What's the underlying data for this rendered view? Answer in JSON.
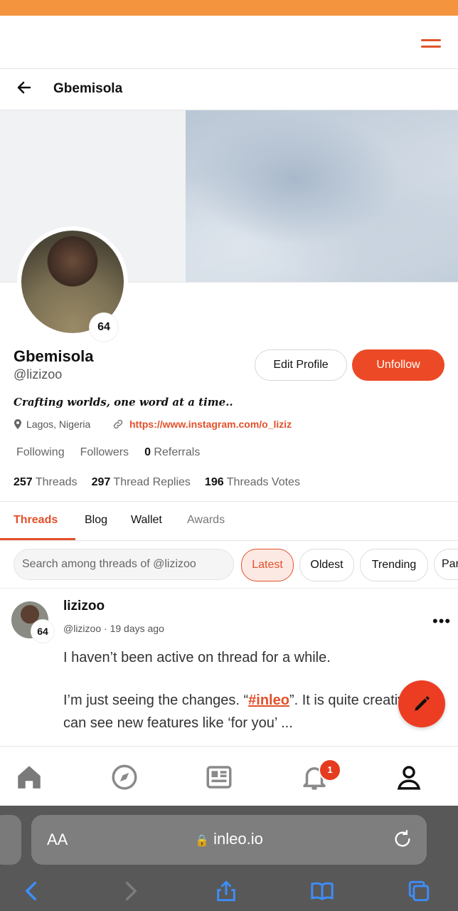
{
  "profile": {
    "title": "Gbemisola",
    "name": "Gbemisola",
    "handle": "@lizizoo",
    "score": "64",
    "bio": "Crafting worlds, one word at a time..",
    "location": "Lagos, Nigeria",
    "link": "https://www.instagram.com/o_liziz",
    "edit_label": "Edit Profile",
    "unfollow_label": "Unfollow",
    "following_label": "Following",
    "followers_label": "Followers",
    "referrals_count": "0",
    "referrals_label": "Referrals",
    "threads_count": "257",
    "threads_label": "Threads",
    "replies_count": "297",
    "replies_label": "Thread Replies",
    "votes_count": "196",
    "votes_label": "Threads Votes"
  },
  "tabs": [
    "Threads",
    "Blog",
    "Wallet",
    "Awards"
  ],
  "search": {
    "placeholder": "Search among threads of @lizizoo"
  },
  "filters": [
    "Latest",
    "Oldest",
    "Trending",
    "Par"
  ],
  "post": {
    "author": "lizizoo",
    "handle": "@lizizoo",
    "time": "19 days ago",
    "badge": "64",
    "line1": "I haven’t been active on thread for a while.",
    "line2_pre": "I’m just seeing the changes. “",
    "hashtag": "#inleo",
    "line2_post": "”. It is quite creative. I can see new features like ‘for you’ ..."
  },
  "nav": {
    "notification_count": "1"
  },
  "browser": {
    "text_size": "AA",
    "url": "inleo.io"
  },
  "colors": {
    "accent": "#ec4a26",
    "topbar": "#f5943f"
  }
}
